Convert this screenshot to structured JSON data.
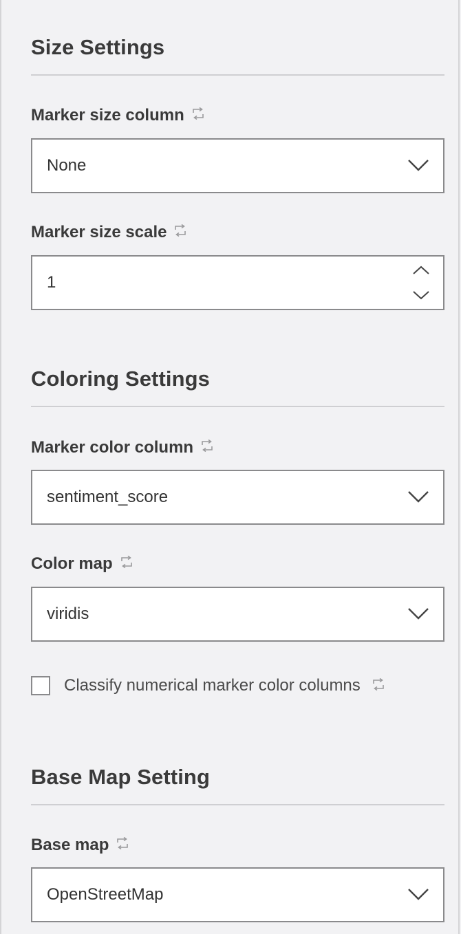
{
  "size_settings": {
    "title": "Size Settings",
    "marker_size_column": {
      "label": "Marker size column",
      "value": "None",
      "sync_icon": "sync-icon"
    },
    "marker_size_scale": {
      "label": "Marker size scale",
      "value": "1",
      "sync_icon": "sync-icon"
    }
  },
  "coloring_settings": {
    "title": "Coloring Settings",
    "marker_color_column": {
      "label": "Marker color column",
      "value": "sentiment_score",
      "sync_icon": "sync-icon"
    },
    "color_map": {
      "label": "Color map",
      "value": "viridis",
      "sync_icon": "sync-icon"
    },
    "classify_checkbox": {
      "label": "Classify numerical marker color columns",
      "checked": false,
      "sync_icon": "sync-icon"
    }
  },
  "base_map_setting": {
    "title": "Base Map Setting",
    "base_map": {
      "label": "Base map",
      "value": "OpenStreetMap",
      "sync_icon": "sync-icon"
    }
  },
  "colors": {
    "panel_background": "#f2f2f4",
    "input_background": "#ffffff",
    "input_border": "#8a8a8c",
    "text": "#3a3a3a",
    "divider": "#cfcfd2",
    "icon": "#9a9a9c"
  }
}
